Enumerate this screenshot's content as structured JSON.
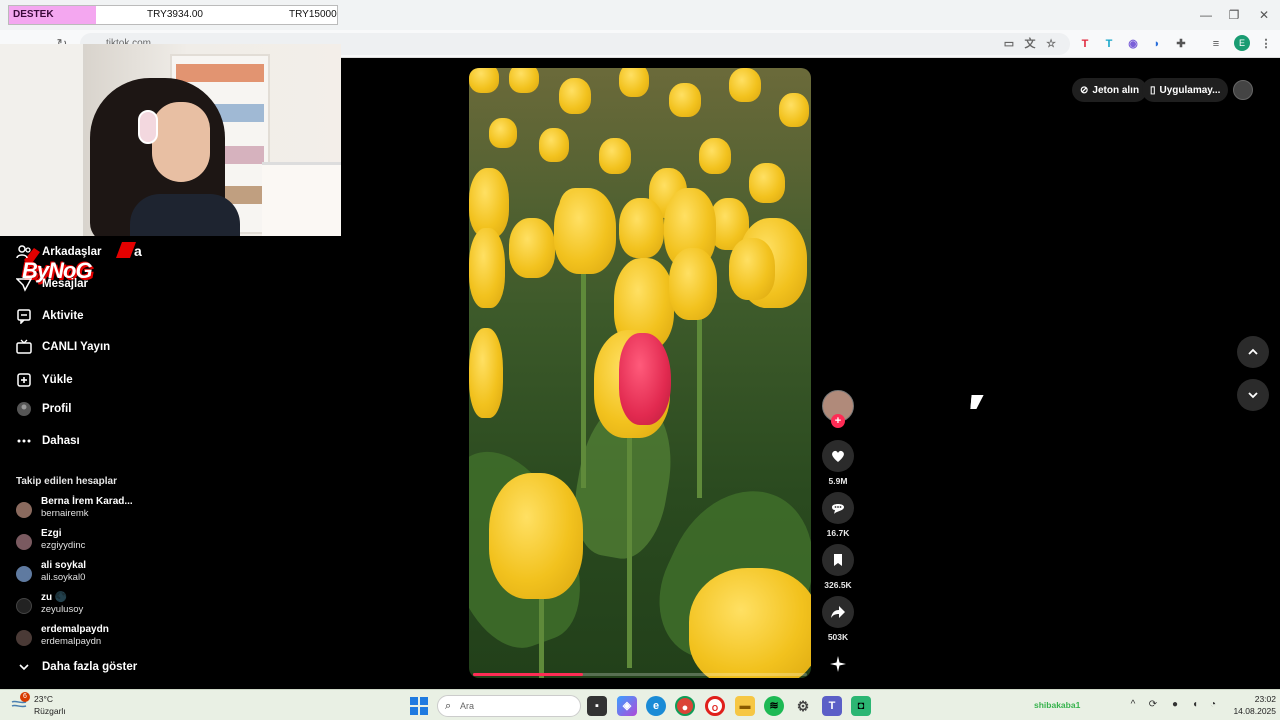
{
  "browser": {
    "url": "tiktok.com",
    "window_controls": [
      "—",
      "❐",
      "✕"
    ],
    "profile_initial": "E"
  },
  "donation": {
    "label": "DESTEK",
    "amount": "TRY3934.00",
    "goal": "TRY15000",
    "progress_fraction": 0.26
  },
  "sidebar": {
    "items": [
      {
        "label": "Arkadaşlar",
        "icon": "friends-icon"
      },
      {
        "label": "Mesajlar",
        "icon": "messages-icon"
      },
      {
        "label": "Aktivite",
        "icon": "activity-icon"
      },
      {
        "label": "CANLI Yayın",
        "icon": "live-icon"
      },
      {
        "label": "Yükle",
        "icon": "upload-icon"
      },
      {
        "label": "Profil",
        "icon": "profile-icon"
      },
      {
        "label": "Dahası",
        "icon": "more-icon"
      }
    ],
    "following_title": "Takip edilen hesaplar",
    "following": [
      {
        "name": "Berna İrem Karad...",
        "user": "bernairemk",
        "color": "#8a6a5e"
      },
      {
        "name": "Ezgi",
        "user": "ezgiyydinc",
        "color": "#7a5a60"
      },
      {
        "name": "ali soykal",
        "user": "ali.soykal0",
        "color": "#5f7aa0"
      },
      {
        "name": "zu 🌑",
        "user": "zeyulusoy",
        "color": "#222222"
      },
      {
        "name": "erdemalpaydn",
        "user": "erdemalpaydn",
        "color": "#4a3a36"
      }
    ],
    "show_more": "Daha fazla göster"
  },
  "logo": {
    "text": "ByNoG"
  },
  "video": {
    "progress_fraction": 0.33
  },
  "actions": {
    "likes": "5.9M",
    "comments": "16.7K",
    "saves": "326.5K",
    "shares": "503K"
  },
  "topbar": {
    "coins": "Jeton alın",
    "app": "Uygulamay..."
  },
  "taskbar": {
    "temperature": "23°C",
    "condition": "Rüzgarlı",
    "notification_count": "6",
    "search_placeholder": "Ara",
    "ticker": "shibakaba1",
    "time": "23:02",
    "date": "14.08.2025"
  },
  "colors": {
    "accent": "#fe2c55",
    "donation_fill": "#f4a7f0"
  }
}
